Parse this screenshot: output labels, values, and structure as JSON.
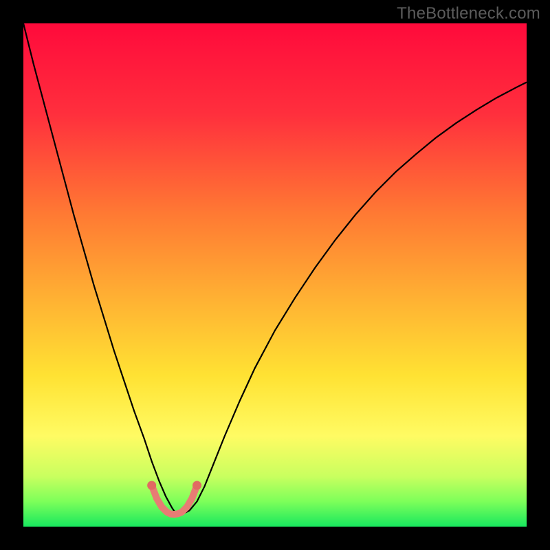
{
  "watermark": {
    "text": "TheBottleneck.com"
  },
  "chart_data": {
    "type": "line",
    "title": "",
    "xlabel": "",
    "ylabel": "",
    "ylim": [
      0,
      100
    ],
    "xlim": [
      0,
      100
    ],
    "gradient_stops": [
      {
        "pct": 0,
        "color": "#ff0a3b"
      },
      {
        "pct": 18,
        "color": "#ff2f3d"
      },
      {
        "pct": 38,
        "color": "#ff7a33"
      },
      {
        "pct": 55,
        "color": "#ffb233"
      },
      {
        "pct": 70,
        "color": "#ffe233"
      },
      {
        "pct": 82,
        "color": "#fffb63"
      },
      {
        "pct": 90,
        "color": "#c9ff5f"
      },
      {
        "pct": 95,
        "color": "#7dff5a"
      },
      {
        "pct": 100,
        "color": "#18e85e"
      }
    ],
    "series": [
      {
        "name": "bottleneck-curve",
        "color": "#000000",
        "width": 2.2,
        "x": [
          0,
          2,
          4,
          6,
          8,
          10,
          12,
          14,
          16,
          18,
          20,
          22,
          24,
          25.5,
          27,
          28.3,
          29.5,
          30.3,
          31.6,
          33,
          34.5,
          36,
          38,
          40,
          43,
          46,
          50,
          54,
          58,
          62,
          66,
          70,
          74,
          78,
          82,
          86,
          90,
          94,
          98,
          100
        ],
        "y": [
          100,
          92,
          84.5,
          77,
          69.5,
          62,
          55,
          48,
          41.5,
          35,
          29,
          23,
          17.5,
          13,
          9,
          6,
          3.8,
          2.6,
          2.5,
          3.2,
          5,
          8,
          13,
          18,
          25,
          31.5,
          39,
          45.5,
          51.5,
          57,
          62,
          66.5,
          70.5,
          74,
          77.3,
          80.2,
          82.8,
          85.2,
          87.3,
          88.3
        ]
      },
      {
        "name": "valley-marker",
        "type": "marker-arc",
        "color": "#e77c74",
        "stroke_width": 10,
        "x": [
          25.5,
          26.5,
          27.5,
          28.5,
          29.3,
          30.0,
          30.7,
          31.5,
          32.5,
          33.5,
          34.5
        ],
        "y": [
          8.2,
          5.6,
          3.9,
          2.9,
          2.5,
          2.45,
          2.55,
          2.9,
          3.9,
          5.6,
          8.2
        ]
      }
    ],
    "valley_dots": {
      "color": "#e16a62",
      "radius": 6.5,
      "points": [
        {
          "x": 25.5,
          "y": 8.2
        },
        {
          "x": 34.5,
          "y": 8.2
        }
      ]
    }
  }
}
